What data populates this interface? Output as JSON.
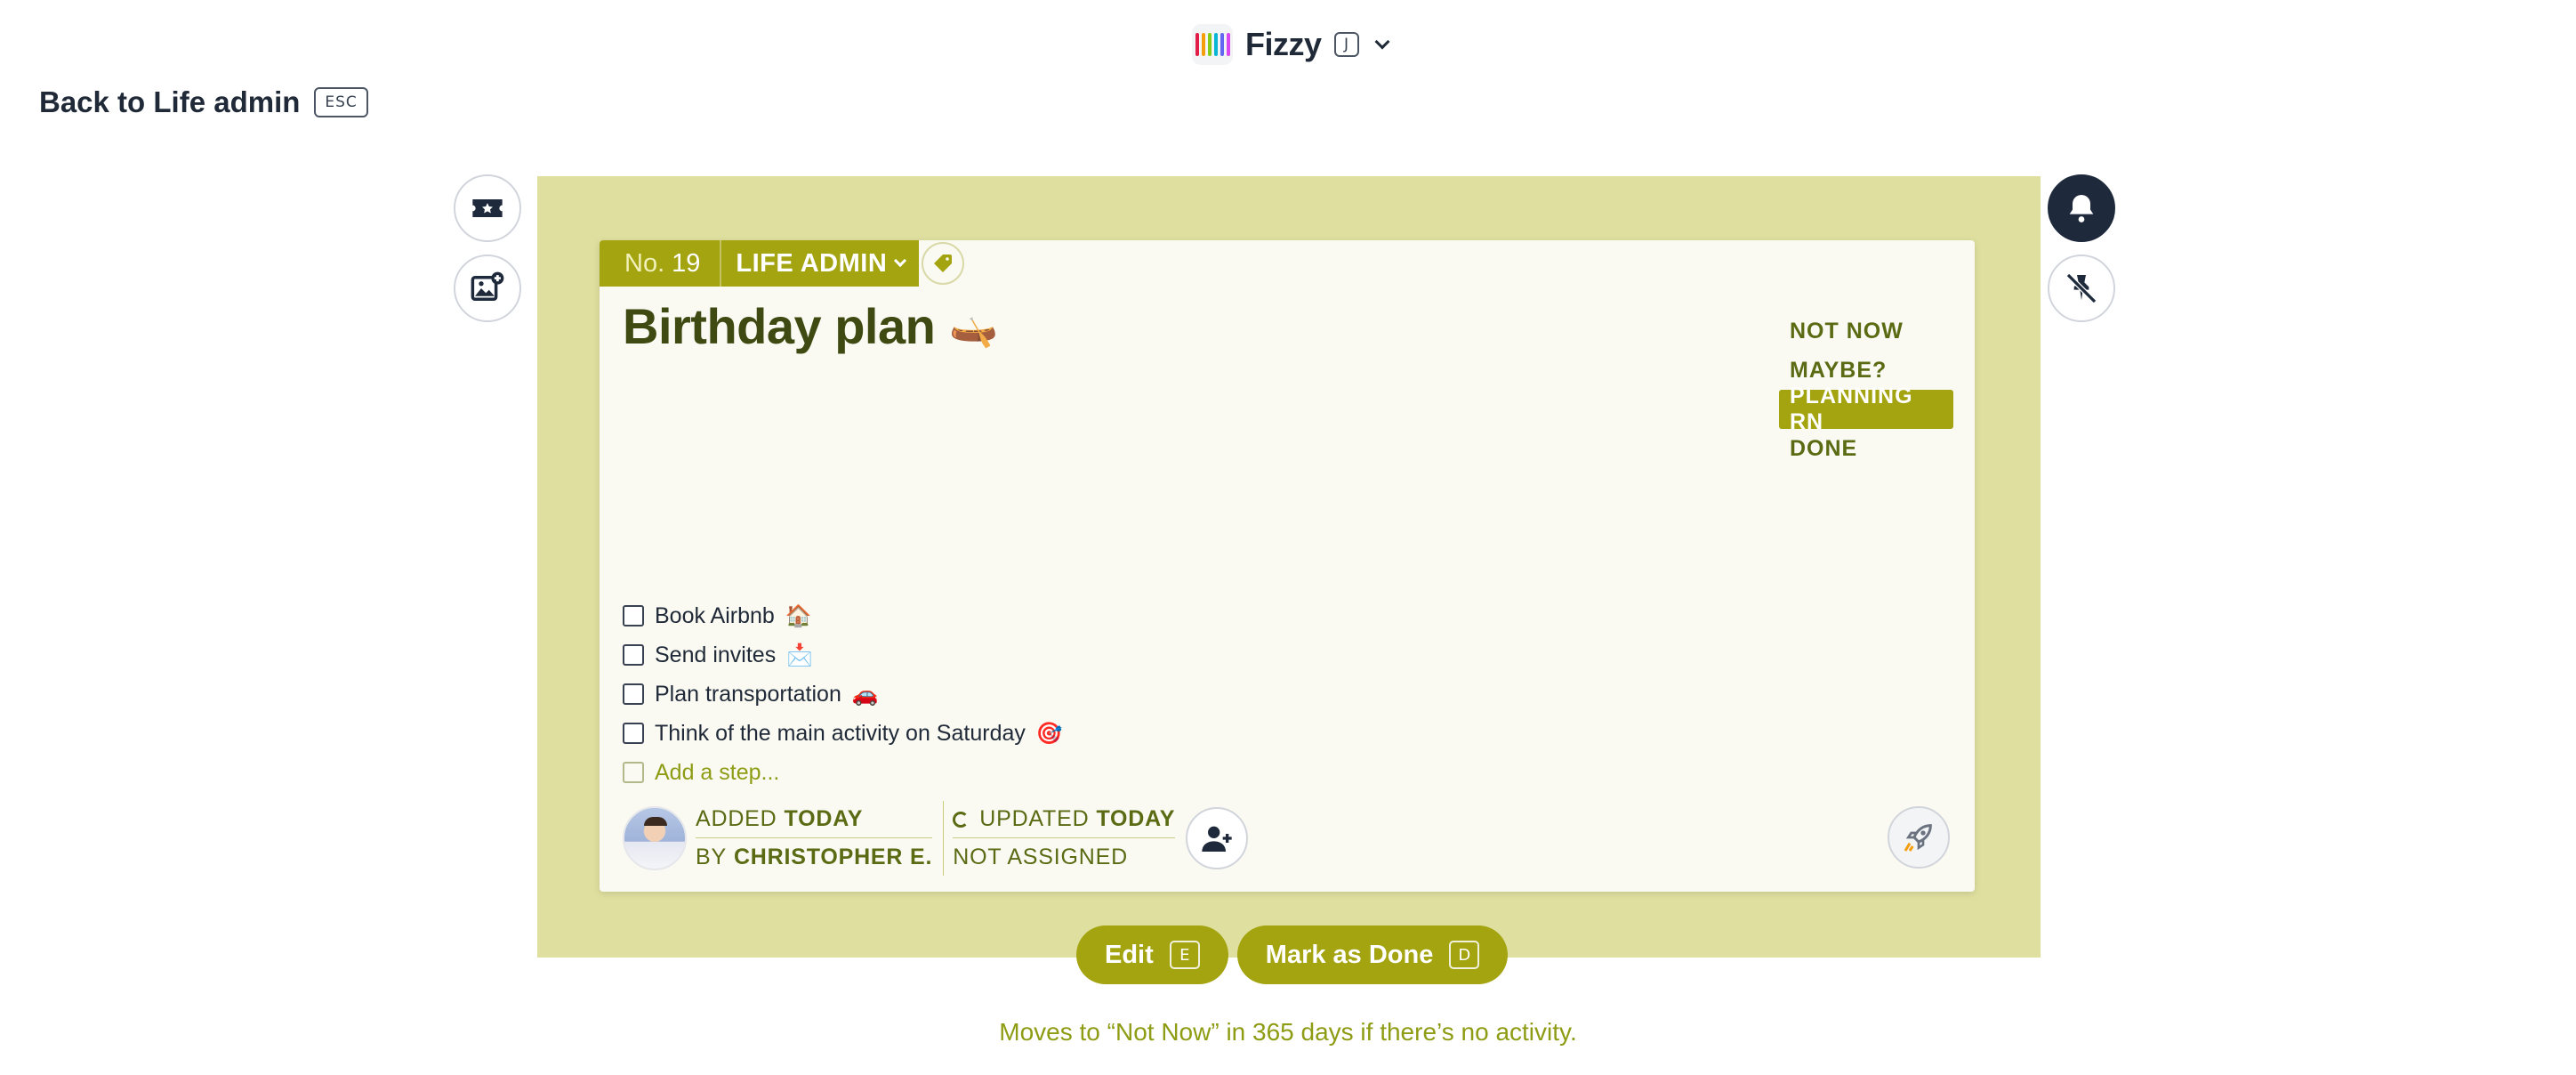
{
  "app": {
    "name": "Fizzy",
    "shortcut": "J",
    "logo_colors": [
      "#e11d48",
      "#f59e0b",
      "#84cc16",
      "#06b6d4",
      "#6366f1",
      "#d946ef"
    ]
  },
  "nav": {
    "back_label": "Back to Life admin",
    "back_shortcut": "ESC"
  },
  "side_buttons": {
    "left": [
      "ticket-icon",
      "add-image-icon"
    ],
    "right": [
      "bell-icon",
      "unpin-icon"
    ]
  },
  "card": {
    "number_prefix": "No.",
    "number": "19",
    "board": "LIFE ADMIN",
    "title": "Birthday plan",
    "title_emoji": "🛶",
    "stages": [
      {
        "label": "NOT NOW",
        "active": false
      },
      {
        "label": "MAYBE?",
        "active": false
      },
      {
        "label": "PLANNING RN",
        "active": true
      },
      {
        "label": "DONE",
        "active": false
      }
    ],
    "steps": [
      {
        "label": "Book Airbnb",
        "emoji": "🏠",
        "checked": false
      },
      {
        "label": "Send invites",
        "emoji": "📩",
        "checked": false
      },
      {
        "label": "Plan transportation",
        "emoji": "🚗",
        "checked": false
      },
      {
        "label": "Think of the main activity on Saturday",
        "emoji": "🎯",
        "checked": false
      }
    ],
    "add_step_placeholder": "Add a step...",
    "meta": {
      "added_label": "ADDED",
      "added_value": "TODAY",
      "by_label": "BY",
      "by_value": "CHRISTOPHER E.",
      "updated_label": "UPDATED",
      "updated_value": "TODAY",
      "assigned": "NOT ASSIGNED"
    }
  },
  "actions": {
    "edit_label": "Edit",
    "edit_shortcut": "E",
    "done_label": "Mark as Done",
    "done_shortcut": "D"
  },
  "footnote": "Moves to “Not Now” in 365 days if there’s no activity.",
  "colors": {
    "accent": "#a3a40f",
    "backdrop": "#dfdf9f",
    "card_bg": "#fafaf3",
    "title": "#3f4a12",
    "muted_text": "#8e9c14"
  }
}
